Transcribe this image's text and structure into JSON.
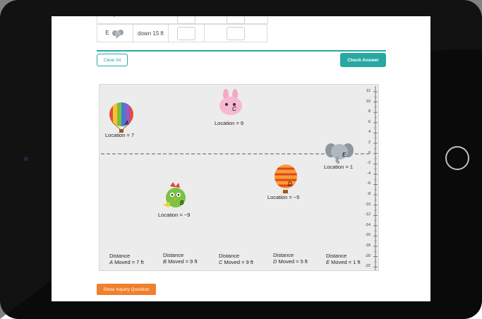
{
  "table": {
    "rows": [
      {
        "letter": "E",
        "direction": "down 15 ft"
      }
    ]
  },
  "buttons": {
    "clear_all": "Clear All",
    "check_answer": "Check Answer",
    "show_inquiry": "Show Inquiry Question"
  },
  "graph": {
    "axis_ticks": [
      "12",
      "10",
      "8",
      "6",
      "4",
      "2",
      "0",
      "-2",
      "-4",
      "-6",
      "-8",
      "-10",
      "-12",
      "-14",
      "-16",
      "-18",
      "-20",
      "-22"
    ],
    "characters": [
      {
        "letter": "A",
        "label": "Location = 7",
        "kind": "balloon-striped"
      },
      {
        "letter": "C",
        "label": "Location = 9",
        "kind": "pink-bunny"
      },
      {
        "letter": "E",
        "label": "Location = 1",
        "kind": "gray-elephant"
      },
      {
        "letter": "D",
        "label": "Location = −5",
        "kind": "balloon-orange"
      },
      {
        "letter": "B",
        "label": "Location = −9",
        "kind": "green-bird"
      }
    ],
    "distances": [
      {
        "line1": "Distance",
        "letter": "A",
        "line2": " Moved = 7 ft"
      },
      {
        "line1": "Distance",
        "letter": "B",
        "line2": " Moved = 9 ft"
      },
      {
        "line1": "Distance",
        "letter": "C",
        "line2": " Moved = 9 ft"
      },
      {
        "line1": "Distance",
        "letter": "D",
        "line2": " Moved = 5 ft"
      },
      {
        "line1": "Distance",
        "letter": "E",
        "line2": " Moved = 1 ft"
      }
    ]
  },
  "colors": {
    "accent": "#27a8a3",
    "inquiry": "#f0802c"
  }
}
